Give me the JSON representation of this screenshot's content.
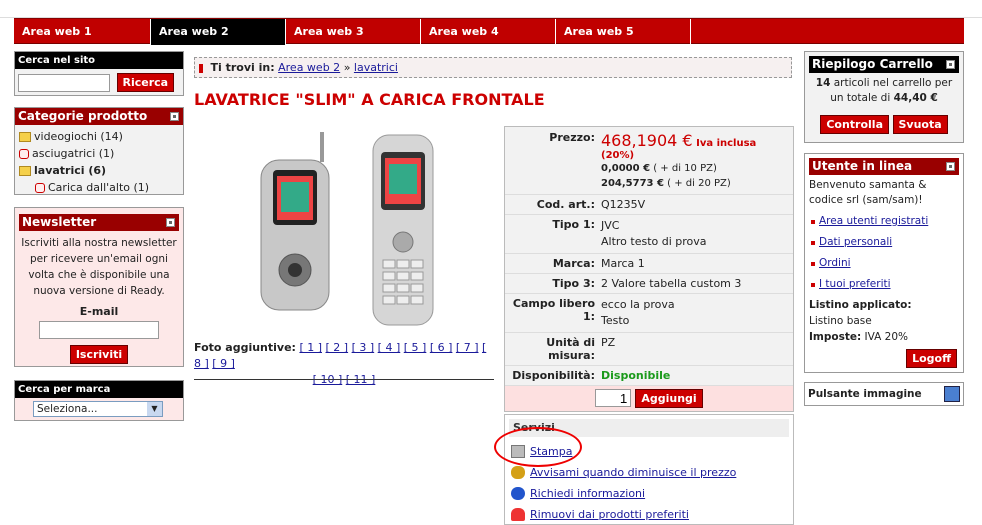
{
  "tabs": [
    "Area web 1",
    "Area web 2",
    "Area web 3",
    "Area web 4",
    "Area web 5"
  ],
  "search": {
    "title": "Cerca nel sito",
    "button": "Ricerca",
    "value": ""
  },
  "categories": {
    "title": "Categorie prodotto",
    "items": [
      "videogiochi (14)",
      "asciugatrici (1)",
      "lavatrici (6)",
      "Carica dall'alto (1)"
    ]
  },
  "newsletter": {
    "title": "Newsletter",
    "text": "Iscriviti alla nostra newsletter per ricevere un'email ogni volta che è disponibile una nuova versione di Ready.",
    "email_label": "E-mail",
    "button": "Iscriviti"
  },
  "brand": {
    "title": "Cerca per marca",
    "select": "Seleziona..."
  },
  "breadcrumb": {
    "prefix": "Ti trovi in:",
    "link1": "Area web 2",
    "sep": "»",
    "link2": "lavatrici"
  },
  "product": {
    "title": "LAVATRICE \"SLIM\" A CARICA FRONTALE",
    "price_label": "Prezzo:",
    "price": "468,1904 €",
    "price_note": "Iva inclusa",
    "price_note2": "(20%)",
    "tier1": "0,0000 €",
    "tier1_note": "( + di 10 PZ)",
    "tier2": "204,5773 €",
    "tier2_note": "( + di 20 PZ)",
    "code_label": "Cod. art.:",
    "code": "Q1235V",
    "type1_label": "Tipo 1:",
    "type1": "JVC",
    "type1_b": "Altro testo di prova",
    "brand_label": "Marca:",
    "brand": "Marca 1",
    "type3_label": "Tipo 3:",
    "type3": "2 Valore tabella custom 3",
    "free_label": "Campo libero 1:",
    "free": "ecco la prova",
    "free_b": "Testo",
    "unit_label": "Unità di misura:",
    "unit": "PZ",
    "avail_label": "Disponibilità:",
    "avail": "Disponibile",
    "qty": "1",
    "add_button": "Aggiungi",
    "photos_label": "Foto aggiuntive:",
    "photos": [
      "[ 1 ]",
      "[ 2 ]",
      "[ 3 ]",
      "[ 4 ]",
      "[ 5 ]",
      "[ 6 ]",
      "[ 7 ]",
      "[ 8 ]",
      "[ 9 ]",
      "[ 10 ]",
      "[ 11 ]"
    ]
  },
  "services": {
    "title": "Servizi",
    "items": [
      "Stampa",
      "Avvisami quando diminuisce il prezzo",
      "Richiedi informazioni",
      "Rimuovi dai prodotti preferiti"
    ]
  },
  "cart": {
    "title": "Riepilogo Carrello",
    "count": "14",
    "text1": "articoli nel carrello per un totale di",
    "total": "44,40 €",
    "btn1": "Controlla",
    "btn2": "Svuota"
  },
  "user": {
    "title": "Utente in linea",
    "welcome": "Benvenuto samanta & codice srl (sam/sam)!",
    "links": [
      "Area utenti registrati",
      "Dati personali",
      "Ordini",
      "I tuoi preferiti"
    ],
    "list_label": "Listino applicato:",
    "list": "Listino base",
    "tax_label": "Imposte:",
    "tax": "IVA 20%",
    "logoff": "Logoff"
  },
  "image_button": {
    "label": "Pulsante immagine"
  }
}
